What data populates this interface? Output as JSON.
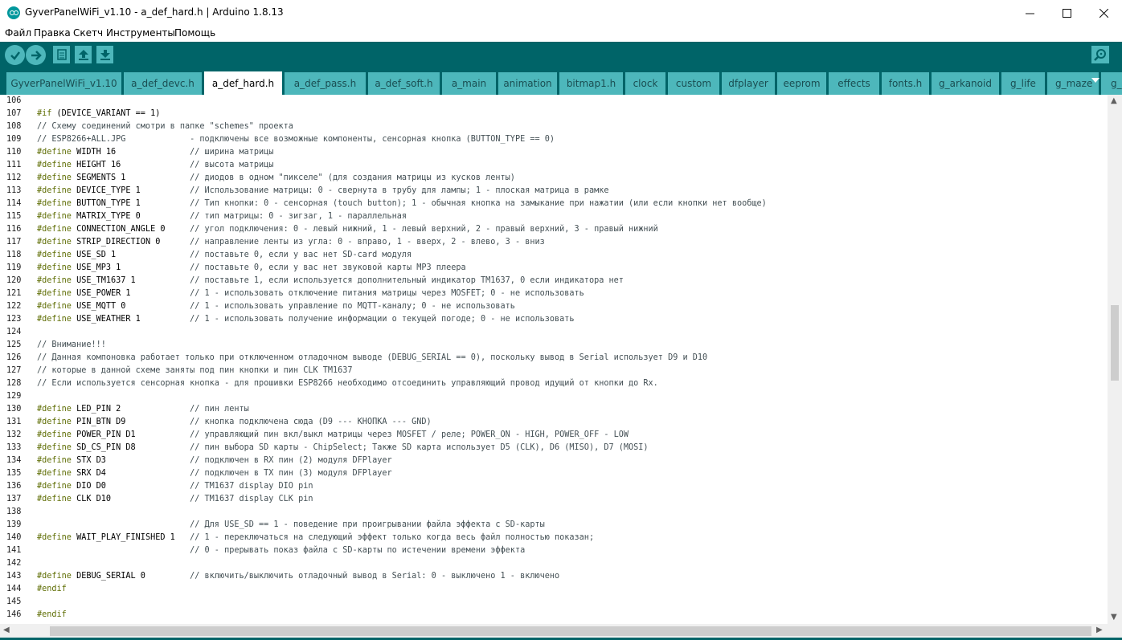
{
  "window": {
    "title": "GyverPanelWiFi_v1.10 - a_def_hard.h | Arduino 1.8.13",
    "controls": [
      "minimize-icon",
      "maximize-icon",
      "close-icon"
    ]
  },
  "menu": [
    "Файл",
    "Правка",
    "Скетч",
    "Инструменты",
    "Помощь"
  ],
  "toolbar": {
    "buttons": [
      "verify-icon",
      "upload-icon",
      "new-icon",
      "open-icon",
      "save-icon"
    ],
    "serial_monitor": "serial-monitor-icon"
  },
  "tabs": [
    "GyverPanelWiFi_v1.10",
    "a_def_devc.h",
    "a_def_hard.h",
    "a_def_pass.h",
    "a_def_soft.h",
    "a_main",
    "animation",
    "bitmap1.h",
    "clock",
    "custom",
    "dfplayer",
    "eeprom",
    "effects",
    "fonts.h",
    "g_arkanoid",
    "g_life",
    "g_maze",
    "g_"
  ],
  "active_tab": "a_def_hard.h",
  "code_lines": [
    {
      "n": "106",
      "pre": "",
      "c": ""
    },
    {
      "n": "107",
      "pre": "#if",
      "c": " (DEVICE_VARIANT == 1)"
    },
    {
      "n": "108",
      "pre": "",
      "c": "// Схему соединений смотри в папке \"schemes\" проекта"
    },
    {
      "n": "109",
      "pre": "",
      "c": "// ESP8266+ALL.JPG             - подключены все возможные компоненты, сенсорная кнопка (BUTTON_TYPE == 0)"
    },
    {
      "n": "110",
      "pre": "#define",
      "c": " WIDTH 16               // ширина матрицы"
    },
    {
      "n": "111",
      "pre": "#define",
      "c": " HEIGHT 16              // высота матрицы"
    },
    {
      "n": "112",
      "pre": "#define",
      "c": " SEGMENTS 1             // диодов в одном \"пикселе\" (для создания матрицы из кусков ленты)"
    },
    {
      "n": "113",
      "pre": "#define",
      "c": " DEVICE_TYPE 1          // Использование матрицы: 0 - свернута в трубу для лампы; 1 - плоская матрица в рамке"
    },
    {
      "n": "114",
      "pre": "#define",
      "c": " BUTTON_TYPE 1          // Тип кнопки: 0 - сенсорная (touch button); 1 - обычная кнопка на замыкание при нажатии (или если кнопки нет вообще)"
    },
    {
      "n": "115",
      "pre": "#define",
      "c": " MATRIX_TYPE 0          // тип матрицы: 0 - зигзаг, 1 - параллельная"
    },
    {
      "n": "116",
      "pre": "#define",
      "c": " CONNECTION_ANGLE 0     // угол подключения: 0 - левый нижний, 1 - левый верхний, 2 - правый верхний, 3 - правый нижний"
    },
    {
      "n": "117",
      "pre": "#define",
      "c": " STRIP_DIRECTION 0      // направление ленты из угла: 0 - вправо, 1 - вверх, 2 - влево, 3 - вниз"
    },
    {
      "n": "118",
      "pre": "#define",
      "c": " USE_SD 1               // поставьте 0, если у вас нет SD-card модуля"
    },
    {
      "n": "119",
      "pre": "#define",
      "c": " USE_MP3 1              // поставьте 0, если у вас нет звуковой карты MP3 плеера"
    },
    {
      "n": "120",
      "pre": "#define",
      "c": " USE_TM1637 1           // поставьте 1, если используется дополнительный индикатор TM1637, 0 если индикатора нет"
    },
    {
      "n": "121",
      "pre": "#define",
      "c": " USE_POWER 1            // 1 - использовать отключение питания матрицы через MOSFET; 0 - не использовать"
    },
    {
      "n": "122",
      "pre": "#define",
      "c": " USE_MQTT 0             // 1 - использовать управление по MQTT-каналу; 0 - не использовать"
    },
    {
      "n": "123",
      "pre": "#define",
      "c": " USE_WEATHER 1          // 1 - использовать получение информации о текущей погоде; 0 - не использовать"
    },
    {
      "n": "124",
      "pre": "",
      "c": ""
    },
    {
      "n": "125",
      "pre": "",
      "c": "// Внимание!!!"
    },
    {
      "n": "126",
      "pre": "",
      "c": "// Данная компоновка работает только при отключенном отладочном выводе (DEBUG_SERIAL == 0), поскольку вывод в Serial использует D9 и D10"
    },
    {
      "n": "127",
      "pre": "",
      "c": "// которые в данной схеме заняты под пин кнопки и пин CLK TM1637"
    },
    {
      "n": "128",
      "pre": "",
      "c": "// Если используется сенсорная кнопка - для прошивки ESP8266 необходимо отсоединить управляющий провод идущий от кнопки до Rx."
    },
    {
      "n": "129",
      "pre": "",
      "c": ""
    },
    {
      "n": "130",
      "pre": "#define",
      "c": " LED_PIN 2              // пин ленты"
    },
    {
      "n": "131",
      "pre": "#define",
      "c": " PIN_BTN D9             // кнопка подключена сюда (D9 --- КНОПКА --- GND)"
    },
    {
      "n": "132",
      "pre": "#define",
      "c": " POWER_PIN D1           // управляющий пин вкл/выкл матрицы через MOSFET / реле; POWER_ON - HIGH, POWER_OFF - LOW"
    },
    {
      "n": "133",
      "pre": "#define",
      "c": " SD_CS_PIN D8           // пин выбора SD карты - ChipSelect; Также SD карта использует D5 (CLK), D6 (MISO), D7 (MOSI)"
    },
    {
      "n": "134",
      "pre": "#define",
      "c": " STX D3                 // подключен в RX пин (2) модуля DFPlayer"
    },
    {
      "n": "135",
      "pre": "#define",
      "c": " SRX D4                 // подключен в TX пин (3) модуля DFPlayer"
    },
    {
      "n": "136",
      "pre": "#define",
      "c": " DIO D0                 // TM1637 display DIO pin"
    },
    {
      "n": "137",
      "pre": "#define",
      "c": " CLK D10                // TM1637 display CLK pin"
    },
    {
      "n": "138",
      "pre": "",
      "c": ""
    },
    {
      "n": "139",
      "pre": "",
      "c": "                               // Для USE_SD == 1 - поведение при проигрывании файла эффекта с SD-карты"
    },
    {
      "n": "140",
      "pre": "#define",
      "c": " WAIT_PLAY_FINISHED 1   // 1 - переключаться на следующий эффект только когда весь файл полностью показан;"
    },
    {
      "n": "141",
      "pre": "",
      "c": "                               // 0 - прерывать показ файла с SD-карты по истечении времени эффекта"
    },
    {
      "n": "142",
      "pre": "",
      "c": ""
    },
    {
      "n": "143",
      "pre": "#define",
      "c": " DEBUG_SERIAL 0         // включить/выключить отладочный вывод в Serial: 0 - выключено 1 - включено"
    },
    {
      "n": "144",
      "pre": "#endif",
      "c": ""
    },
    {
      "n": "145",
      "pre": "",
      "c": ""
    },
    {
      "n": "146",
      "pre": "#endif",
      "c": ""
    }
  ]
}
